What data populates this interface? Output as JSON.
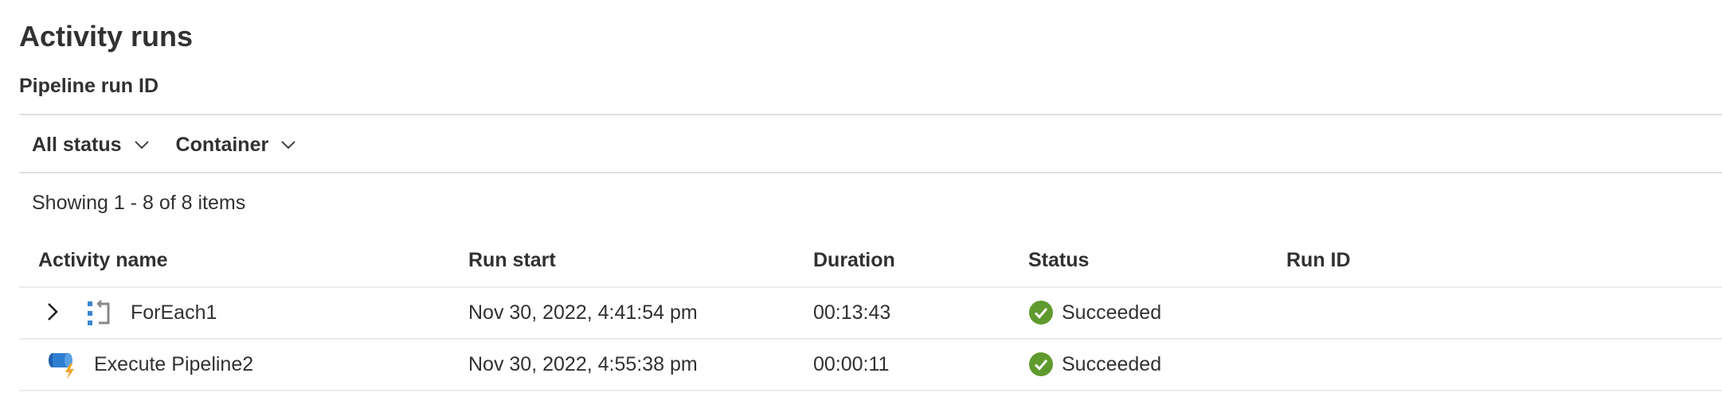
{
  "header": {
    "title": "Activity runs",
    "subtitle": "Pipeline run ID"
  },
  "filters": [
    {
      "label": "All status",
      "icon": "chevron-down-icon"
    },
    {
      "label": "Container",
      "icon": "chevron-down-icon"
    }
  ],
  "summary": {
    "showing": "Showing 1 - 8 of 8 items"
  },
  "table": {
    "columns": [
      "Activity name",
      "Run start",
      "Duration",
      "Status",
      "Run ID"
    ],
    "rows": [
      {
        "name": "ForEach1",
        "icon": "foreach-icon",
        "expandable": true,
        "run_start": "Nov 30, 2022, 4:41:54 pm",
        "duration": "00:13:43",
        "status": "Succeeded",
        "run_id": ""
      },
      {
        "name": "Execute Pipeline2",
        "icon": "execute-pipeline-icon",
        "expandable": false,
        "run_start": "Nov 30, 2022, 4:55:38 pm",
        "duration": "00:00:11",
        "status": "Succeeded",
        "run_id": ""
      }
    ]
  },
  "colors": {
    "success": "#5f9a2f",
    "text": "#323130",
    "divider": "#e1dfdd",
    "foreach_blue": "#3b86cf",
    "pipeline_blue": "#1f5fae",
    "lightning": "#f2a52b"
  }
}
